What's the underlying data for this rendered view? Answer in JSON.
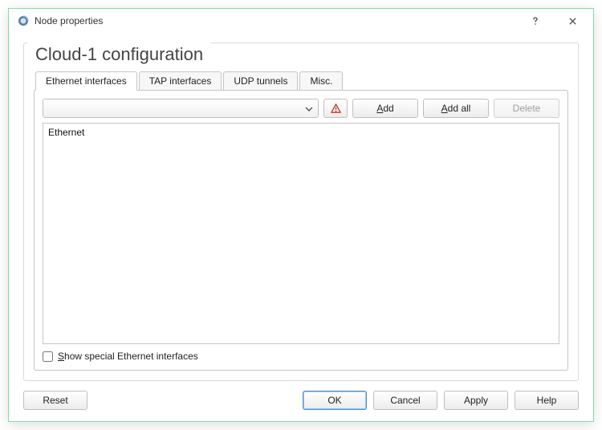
{
  "window": {
    "title": "Node properties"
  },
  "config": {
    "title": "Cloud-1 configuration"
  },
  "tabs": {
    "items": [
      {
        "label": "Ethernet interfaces",
        "active": true
      },
      {
        "label": "TAP interfaces",
        "active": false
      },
      {
        "label": "UDP tunnels",
        "active": false
      },
      {
        "label": "Misc.",
        "active": false
      }
    ]
  },
  "ethernet_tab": {
    "combo_selected": "",
    "buttons": {
      "warn_aria": "Warning",
      "add": "Add",
      "add_hotkey": "A",
      "add_all": "Add all",
      "delete": "Delete"
    },
    "list_items": [
      "Ethernet"
    ],
    "show_special": "Show special Ethernet interfaces"
  },
  "footer": {
    "reset": "Reset",
    "ok": "OK",
    "cancel": "Cancel",
    "apply": "Apply",
    "help": "Help"
  }
}
